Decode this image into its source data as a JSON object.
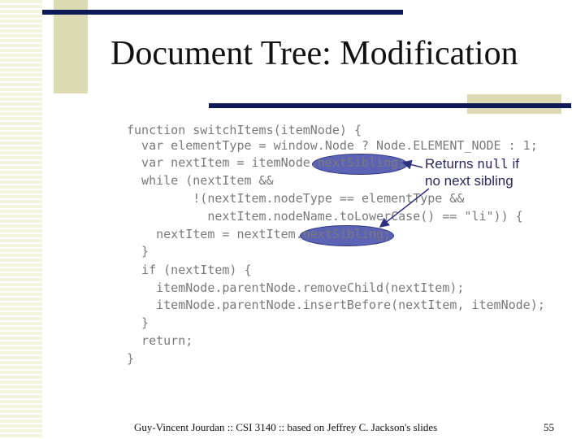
{
  "slide": {
    "title": "Document Tree: Modification",
    "code_lines": [
      "function switchItems(itemNode) {",
      "  var elementType = window.Node ? Node.ELEMENT_NODE : 1;",
      "  var nextItem = itemNode.nextSibling;",
      "  while (nextItem &&",
      "         !(nextItem.nodeType == elementType &&",
      "           nextItem.nodeName.toLowerCase() == \"li\")) {",
      "    nextItem = nextItem.nextSibling;",
      "  }",
      "  if (nextItem) {",
      "    itemNode.parentNode.removeChild(nextItem);",
      "    itemNode.parentNode.insertBefore(nextItem, itemNode);",
      "  }",
      "  return;",
      "}"
    ],
    "callout": {
      "before": "Returns ",
      "code": "null",
      "after": " if",
      "line2": "no next sibling"
    },
    "footer": "Guy-Vincent Jourdan :: CSI 3140 :: based on Jeffrey C. Jackson's slides",
    "page_number": "55"
  }
}
